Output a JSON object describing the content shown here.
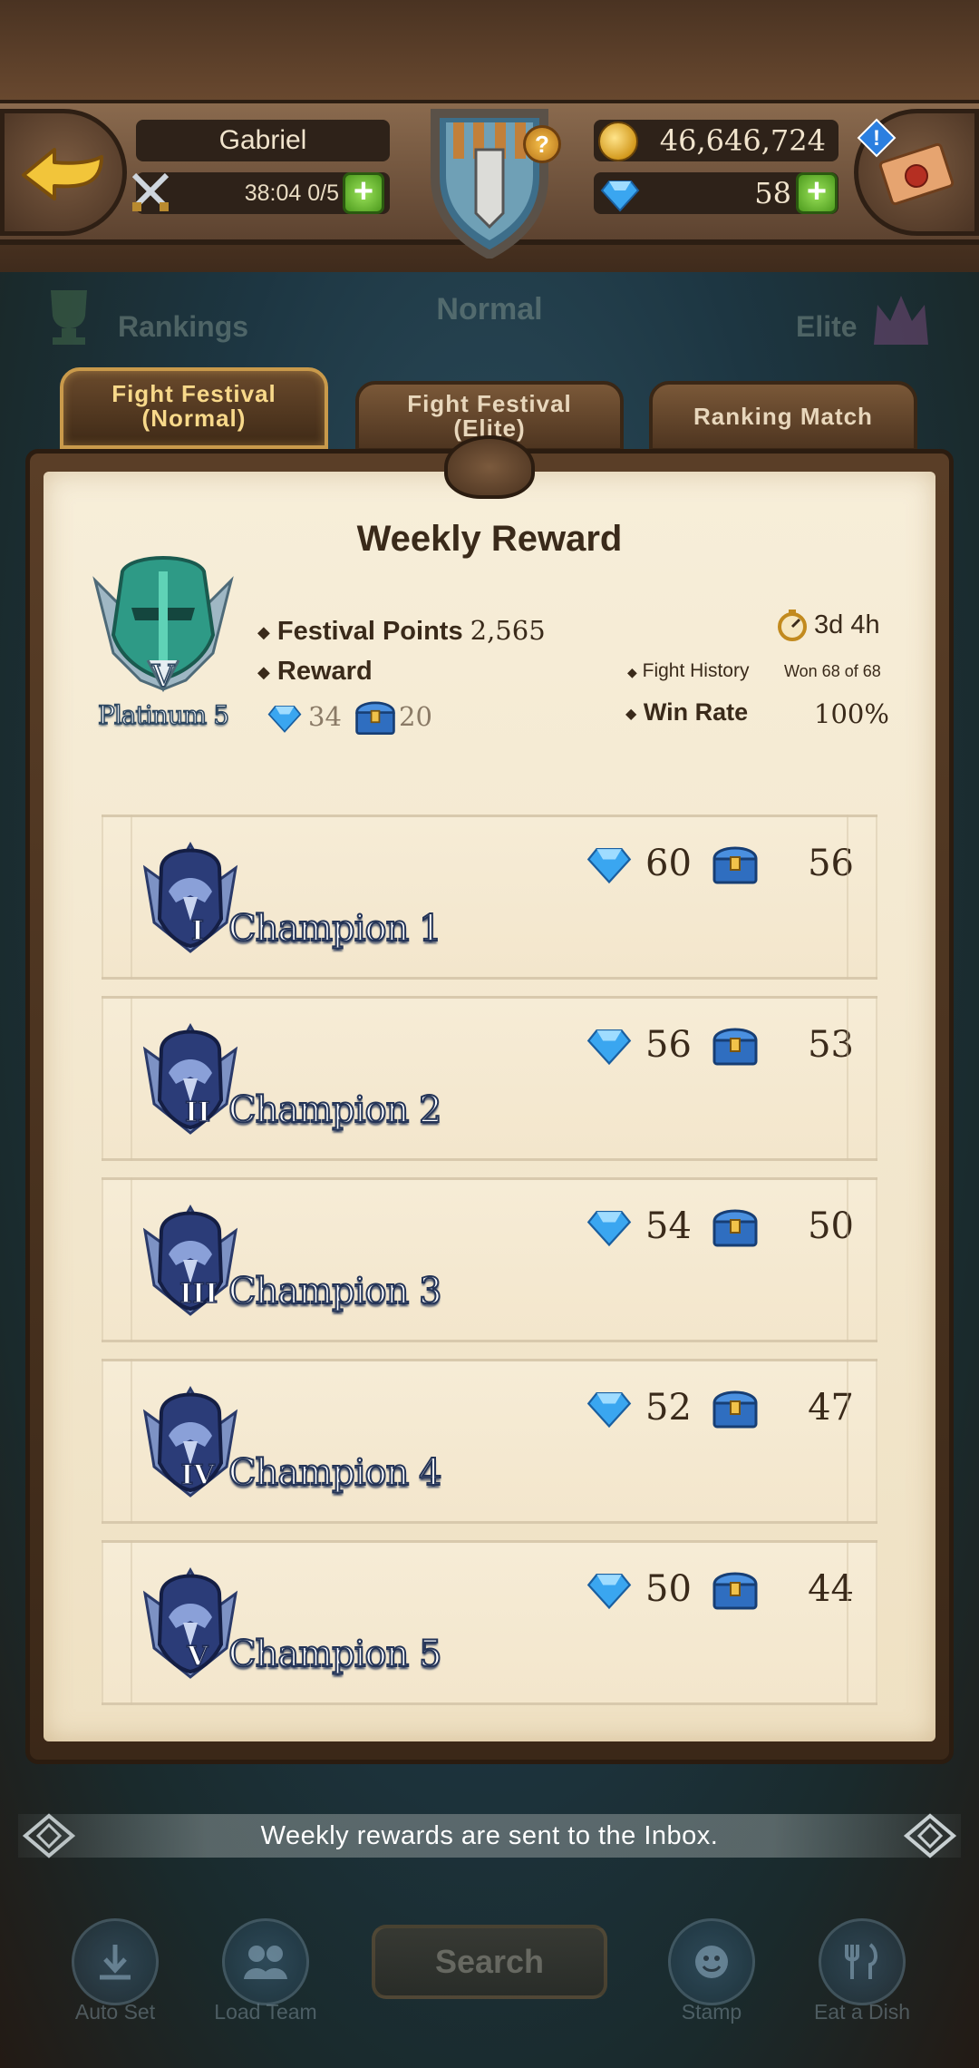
{
  "header": {
    "player_name": "Gabriel",
    "stamina_text": "38:04 0/5",
    "gold": "46,646,724",
    "gems": "58",
    "help_glyph": "?",
    "alert_glyph": "!"
  },
  "modes": {
    "rankings": "Rankings",
    "normal": "Normal",
    "elite": "Elite"
  },
  "tabs": [
    {
      "line1": "Fight Festival",
      "line2": "(Normal)"
    },
    {
      "line1": "Fight Festival",
      "line2": "(Elite)"
    },
    {
      "line1": "Ranking Match",
      "line2": ""
    }
  ],
  "weekly": {
    "title": "Weekly Reward",
    "rank_label": "Platinum 5",
    "rank_numeral": "V",
    "festival_points_label": "Festival Points",
    "festival_points": "2,565",
    "reward_label": "Reward",
    "reward_gems": "34",
    "reward_chests": "20",
    "time_left": "3d 4h",
    "fight_history_label": "Fight History",
    "fight_history": "Won 68 of 68",
    "win_rate_label": "Win Rate",
    "win_rate": "100%"
  },
  "rewards": [
    {
      "numeral": "I",
      "name": "Champion 1",
      "gems": "60",
      "chests": "56"
    },
    {
      "numeral": "II",
      "name": "Champion 2",
      "gems": "56",
      "chests": "53"
    },
    {
      "numeral": "III",
      "name": "Champion 3",
      "gems": "54",
      "chests": "50"
    },
    {
      "numeral": "IV",
      "name": "Champion 4",
      "gems": "52",
      "chests": "47"
    },
    {
      "numeral": "V",
      "name": "Champion 5",
      "gems": "50",
      "chests": "44"
    }
  ],
  "footer": {
    "notice": "Weekly rewards are sent to the Inbox.",
    "auto_set": "Auto Set",
    "load_team": "Load Team",
    "search": "Search",
    "stamp": "Stamp",
    "eat_dish": "Eat a Dish"
  },
  "colors": {
    "parchment": "#f4e9d0",
    "wood": "#5d4330",
    "gem_blue": "#3aa6f0",
    "plus_green": "#6cc232",
    "active_tab_text": "#f8d98a"
  }
}
